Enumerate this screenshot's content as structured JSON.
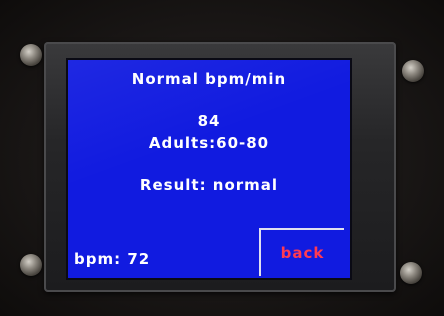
{
  "screen": {
    "title": "Normal bpm/min",
    "bpm_value": "84",
    "adult_range": "Adults:60-80",
    "result": "Result: normal",
    "bpm_reading": "bpm: 72",
    "back_label": "back"
  },
  "colors": {
    "screen_background": "#111be0",
    "text": "#ffffff",
    "back_label": "#ff3a52",
    "bezel": "#262628"
  }
}
